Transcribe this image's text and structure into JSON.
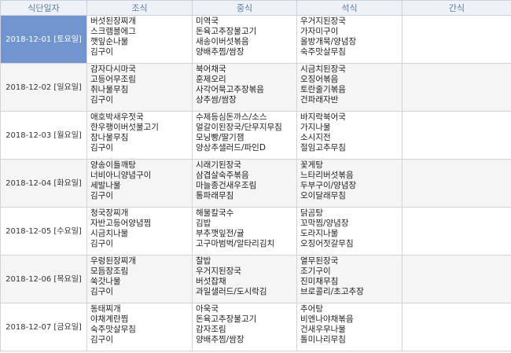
{
  "headers": {
    "date": "식단일자",
    "breakfast": "조식",
    "lunch": "중식",
    "dinner": "석식",
    "snack": "간식"
  },
  "days": [
    {
      "date": "2018-12-01 [토요일]",
      "breakfast": [
        "버섯된장찌개",
        "스크램블에그",
        "깻잎순나물",
        "김구이"
      ],
      "lunch": [
        "미역국",
        "돈육고추장불고기",
        "새송이버섯볶음",
        "양배추찜/쌈장"
      ],
      "dinner": [
        "우거지된장국",
        "가자미구이",
        "올방개묵/양념장",
        "숙주맛살무침"
      ],
      "snack": []
    },
    {
      "date": "2018-12-02 [일요일]",
      "breakfast": [
        "감자다시마국",
        "고등어무조림",
        "취나물무침",
        "김구이"
      ],
      "lunch": [
        "북어채국",
        "훈제오리",
        "사각어묵고추장볶음",
        "상추쌈/쌈장"
      ],
      "dinner": [
        "시금치된장국",
        "오징어볶음",
        "토란줄기볶음",
        "건파래자반"
      ],
      "snack": []
    },
    {
      "date": "2018-12-03 [월요일]",
      "breakfast": [
        "애호박새우젓국",
        "한우팽이버섯불고기",
        "참나물무침",
        "김구이"
      ],
      "lunch": [
        "수제등심돈까스/소스",
        "얼갈이된장국/단무지무침",
        "모닝빵/딸기잼",
        "양상추샐러드/파인D"
      ],
      "dinner": [
        "바지락북어국",
        "가지나물",
        "소시지전",
        "절임고추무침"
      ],
      "snack": []
    },
    {
      "date": "2018-12-04 [화요일]",
      "breakfast": [
        "양송이들깨탕",
        "너비아니양념구이",
        "세발나물",
        "김구이"
      ],
      "lunch": [
        "시래기된장국",
        "삼겹살숙주볶음",
        "마늘종건새우조림",
        "통파래무침"
      ],
      "dinner": [
        "꽃게탕",
        "느타리버섯볶음",
        "두부구이/양념장",
        "오이달래무침"
      ],
      "snack": []
    },
    {
      "date": "2018-12-05 [수요일]",
      "breakfast": [
        "청국장찌개",
        "자반고등어양념찜",
        "시금치나물",
        "김구이"
      ],
      "lunch": [
        "해물칼국수",
        "김밥",
        "부추깻잎전/귤",
        "고구마범벅/알타리김치"
      ],
      "dinner": [
        "닭곰탕",
        "꼬막찜/양념장",
        "도라지나물",
        "오징어젓갈무침"
      ],
      "snack": []
    },
    {
      "date": "2018-12-06 [목요일]",
      "breakfast": [
        "우렁된장찌개",
        "모듬장조림",
        "쑥갓나물",
        "김구이"
      ],
      "lunch": [
        "찰밥",
        "우거지된장국",
        "버섯잡채",
        "과일샐러드/도시락김"
      ],
      "dinner": [
        "열무된장국",
        "조기구이",
        "진미채무침",
        "브로콜리/초고추장"
      ],
      "snack": []
    },
    {
      "date": "2018-12-07 [금요일]",
      "breakfast": [
        "동태찌개",
        "야채계란찜",
        "숙주맛살무침",
        "김구이"
      ],
      "lunch": [
        "아욱국",
        "돈육고추장불고기",
        "감자조림",
        "양배추찜/쌈장"
      ],
      "dinner": [
        "추어탕",
        "비엔나야채볶음",
        "건새우무나물",
        "톨미나리무침"
      ],
      "snack": []
    }
  ]
}
